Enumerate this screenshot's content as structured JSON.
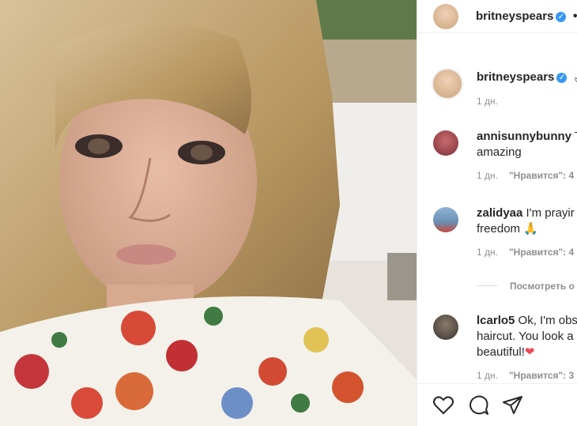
{
  "post": {
    "author": "britneyspears",
    "follow_dot": "•",
    "caption_time": "1 дн.",
    "caption_emoji": "🌶"
  },
  "comments": [
    {
      "user": "annisunnybunny",
      "text": "T amazing",
      "line1": "T",
      "line2": "amazing",
      "time": "1 дн.",
      "likes": "\"Нравится\": 4"
    },
    {
      "user": "zalidyaa",
      "line1": "I'm prayir",
      "line2": "freedom 🙏",
      "time": "1 дн.",
      "likes": "\"Нравится\": 4"
    },
    {
      "user": "lcarlo5",
      "line1": "Ok, I'm obs",
      "line2": "haircut. You look a",
      "line3": "beautiful!",
      "heart": "❤",
      "time": "1 дн.",
      "likes": "\"Нравится\": 3"
    }
  ],
  "view_replies": "Посмотреть о",
  "icons": [
    "heart-icon",
    "comment-icon",
    "share-icon",
    "verified-icon"
  ],
  "colors": {
    "verified": "#3897f0",
    "muted": "#8e8e8e",
    "heart": "#ed4956"
  }
}
